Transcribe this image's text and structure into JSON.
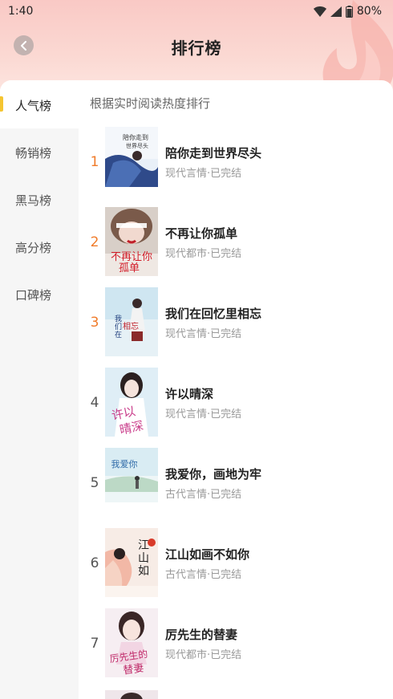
{
  "status_bar": {
    "time": "1:40",
    "battery": "80%"
  },
  "header": {
    "title": "排行榜"
  },
  "sidebar": {
    "items": [
      {
        "label": "人气榜",
        "active": true
      },
      {
        "label": "畅销榜",
        "active": false
      },
      {
        "label": "黑马榜",
        "active": false
      },
      {
        "label": "高分榜",
        "active": false
      },
      {
        "label": "口碑榜",
        "active": false
      }
    ]
  },
  "main": {
    "subtitle": "根据实时阅读热度排行",
    "books": [
      {
        "rank": "1",
        "title": "陪你走到世界尽头",
        "meta": "现代言情·已完结",
        "cover_text": "陪你走到世界尽头"
      },
      {
        "rank": "2",
        "title": "不再让你孤单",
        "meta": "现代都市·已完结",
        "cover_text": "不再让你孤单"
      },
      {
        "rank": "3",
        "title": "我们在回忆里相忘",
        "meta": "现代言情·已完结",
        "cover_text": "我们在回忆里相忘"
      },
      {
        "rank": "4",
        "title": "许以晴深",
        "meta": "现代言情·已完结",
        "cover_text": "许以晴深"
      },
      {
        "rank": "5",
        "title": "我爱你，画地为牢",
        "meta": "古代言情·已完结",
        "cover_text": "我爱你画地为牢"
      },
      {
        "rank": "6",
        "title": "江山如画不如你",
        "meta": "古代言情·已完结",
        "cover_text": "江山如画"
      },
      {
        "rank": "7",
        "title": "厉先生的替妻",
        "meta": "现代都市·已完结",
        "cover_text": "厉先生的替妻"
      }
    ]
  },
  "colors": {
    "accent": "#f07b2a",
    "indicator": "#f5c531",
    "header_pink": "#f9c9c5"
  }
}
